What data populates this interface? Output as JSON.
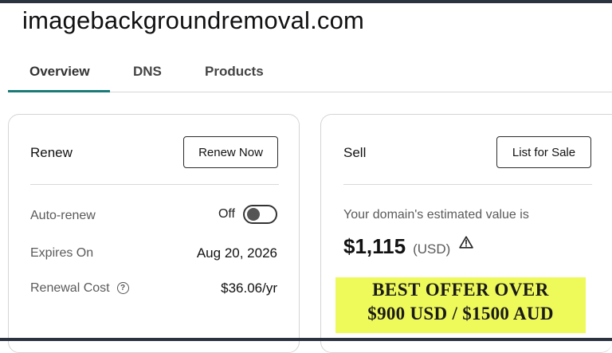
{
  "domain": "imagebackgroundremoval.com",
  "tabs": [
    {
      "label": "Overview",
      "active": true
    },
    {
      "label": "DNS",
      "active": false
    },
    {
      "label": "Products",
      "active": false
    }
  ],
  "renew_card": {
    "heading": "Renew",
    "button_label": "Renew Now",
    "auto_renew_label": "Auto-renew",
    "auto_renew_state": "Off",
    "expires_label": "Expires On",
    "expires_value": "Aug 20, 2026",
    "cost_label": "Renewal Cost",
    "cost_info_icon": "info-icon",
    "cost_value": "$36.06/yr"
  },
  "sell_card": {
    "heading": "Sell",
    "button_label": "List for Sale",
    "estimate_label": "Your domain's estimated value is",
    "estimate_amount": "$1,115",
    "estimate_currency": "(USD)",
    "estimate_icon": "warning-icon"
  },
  "offer_banner": {
    "line1": "BEST OFFER OVER",
    "line2": "$900 USD / $1500 AUD",
    "background": "#eef95a"
  },
  "colors": {
    "accent": "#1a7a78",
    "frame": "#2b3340"
  }
}
